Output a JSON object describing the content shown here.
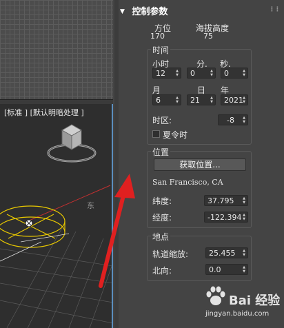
{
  "viewport": {
    "persp_label": "[标准 ] [默认明暗处理 ]",
    "compass_east": "东"
  },
  "panel": {
    "title": "控制参数",
    "azimuth_label": "方位",
    "altitude_label": "海拔高度",
    "azimuth_value": "170",
    "altitude_value": "75",
    "time_group": {
      "title": "时间",
      "hour_label": "小时",
      "minute_label": "分.",
      "second_label": "秒.",
      "hour_value": "12",
      "minute_value": "0",
      "second_value": "0",
      "month_label": "月",
      "day_label": "日",
      "year_label": "年",
      "month_value": "6",
      "day_value": "21",
      "year_value": "2021",
      "timezone_label": "时区:",
      "timezone_value": "-8",
      "dst_label": "夏令时"
    },
    "location_group": {
      "title": "位置",
      "get_location_button": "获取位置...",
      "city": "San Francisco, CA",
      "latitude_label": "纬度:",
      "latitude_value": "37.795",
      "longitude_label": "经度:",
      "longitude_value": "-122.394"
    },
    "site_group": {
      "title": "地点",
      "orbital_scale_label": "轨道缩放:",
      "orbital_scale_value": "25.455",
      "north_label": "北向:",
      "north_value": "0.0"
    }
  },
  "watermark": {
    "brand": "Bai 经验",
    "url": "jingyan.baidu.com"
  },
  "colors": {
    "panel_bg": "#444444",
    "viewport_bg": "#2e2e2e",
    "active_border": "#5b8fbf",
    "annotation_arrow": "#e02020",
    "gizmo_yellow": "#e8c800"
  }
}
